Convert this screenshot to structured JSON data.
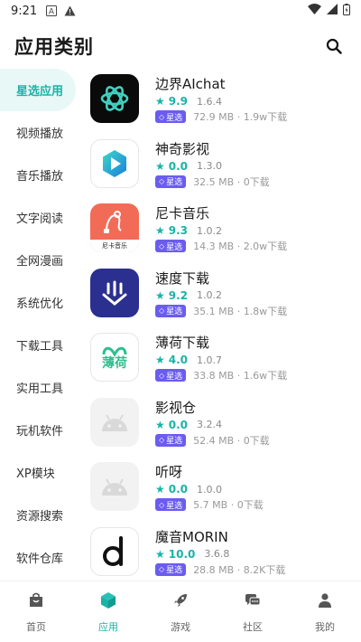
{
  "status": {
    "time": "9:21"
  },
  "header": {
    "title": "应用类别"
  },
  "sidebar": {
    "items": [
      {
        "label": "星选应用",
        "active": true
      },
      {
        "label": "视频播放"
      },
      {
        "label": "音乐播放"
      },
      {
        "label": "文字阅读"
      },
      {
        "label": "全网漫画"
      },
      {
        "label": "系统优化"
      },
      {
        "label": "下载工具"
      },
      {
        "label": "实用工具"
      },
      {
        "label": "玩机软件"
      },
      {
        "label": "XP模块"
      },
      {
        "label": "资源搜索"
      },
      {
        "label": "软件仓库"
      }
    ]
  },
  "apps": [
    {
      "name": "边界AIchat",
      "rating": "9.9",
      "version": "1.6.4",
      "badge": "星选",
      "meta": "72.9 MB · 1.9w下载",
      "icon": "openai-knot-icon"
    },
    {
      "name": "神奇影视",
      "rating": "0.0",
      "version": "1.3.0",
      "badge": "星选",
      "meta": "32.5 MB · 0下载",
      "icon": "play-cube-icon"
    },
    {
      "name": "尼卡音乐",
      "rating": "9.3",
      "version": "1.0.2",
      "badge": "星选",
      "meta": "14.3 MB · 2.0w下载",
      "icon": "music-cable-icon",
      "icon_caption": "尼卡音乐"
    },
    {
      "name": "速度下载",
      "rating": "9.2",
      "version": "1.0.2",
      "badge": "星选",
      "meta": "35.1 MB · 1.8w下载",
      "icon": "download-arrows-icon"
    },
    {
      "name": "薄荷下载",
      "rating": "4.0",
      "version": "1.0.7",
      "badge": "星选",
      "meta": "33.8 MB · 1.6w下载",
      "icon": "mint-icon",
      "icon_caption": "薄荷"
    },
    {
      "name": "影视仓",
      "rating": "0.0",
      "version": "3.2.4",
      "badge": "星选",
      "meta": "52.4 MB · 0下载",
      "icon": "android-placeholder-icon"
    },
    {
      "name": "听呀",
      "rating": "0.0",
      "version": "1.0.0",
      "badge": "星选",
      "meta": "5.7 MB · 0下载",
      "icon": "android-placeholder-icon"
    },
    {
      "name": "魔音MORIN",
      "rating": "10.0",
      "version": "3.6.8",
      "badge": "星选",
      "meta": "28.8 MB · 8.2K下载",
      "icon": "letter-d-icon"
    }
  ],
  "tabbar": {
    "tabs": [
      {
        "label": "首页",
        "icon": "bag-icon"
      },
      {
        "label": "应用",
        "icon": "cube-icon",
        "active": true
      },
      {
        "label": "游戏",
        "icon": "rocket-icon"
      },
      {
        "label": "社区",
        "icon": "chat-icon"
      },
      {
        "label": "我的",
        "icon": "person-icon"
      }
    ]
  },
  "colors": {
    "accent": "#19b3a8",
    "badge": "#6b5cf0"
  }
}
